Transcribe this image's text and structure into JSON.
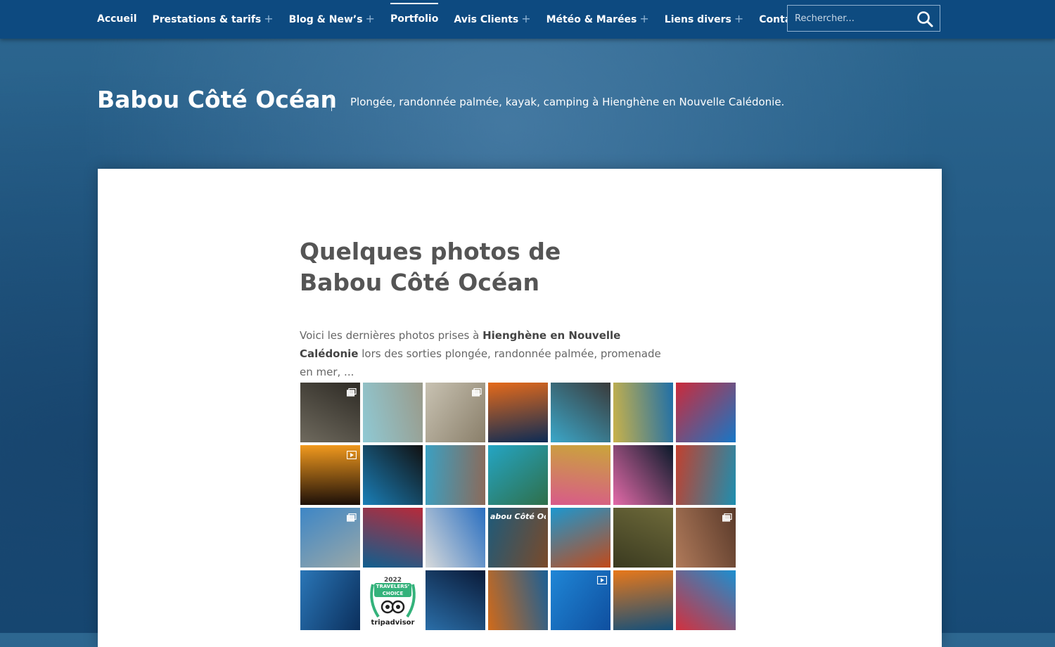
{
  "nav": {
    "items": [
      {
        "label": "Accueil",
        "has_sub": false,
        "active": false
      },
      {
        "label": "Prestations & tarifs",
        "has_sub": true,
        "active": false
      },
      {
        "label": "Blog & New’s",
        "has_sub": true,
        "active": false
      },
      {
        "label": "Portfolio",
        "has_sub": false,
        "active": true
      },
      {
        "label": "Avis Clients",
        "has_sub": true,
        "active": false
      },
      {
        "label": "Météo & Marées",
        "has_sub": true,
        "active": false
      },
      {
        "label": "Liens divers",
        "has_sub": true,
        "active": false
      },
      {
        "label": "Contact",
        "has_sub": true,
        "active": false
      }
    ],
    "sub_indicator": "+"
  },
  "search": {
    "placeholder": "Rechercher...",
    "icon": "search-icon"
  },
  "site": {
    "title": "Babou Côté Océan",
    "tagline": "Plongée, randonnée palmée, kayak, camping à Hienghène en Nouvelle Calédonie."
  },
  "page": {
    "title": "Quelques photos de Babou Côté Océan",
    "intro_before": "Voici les dernières photos prises à ",
    "intro_strong": "Hienghène en Nouvelle Calédonie",
    "intro_after": " lors des sorties plongée, randonnée palmée, promenade en mer, ..."
  },
  "colors": {
    "topbar": "#0d4a80",
    "accent": "#ffffff",
    "tripadvisor": "#34b27b"
  },
  "gallery": [
    {
      "c1": "#6f6a5e",
      "c2": "#2d2a24",
      "badge": "multi"
    },
    {
      "c1": "#8fc9d4",
      "c2": "#9a9a8a",
      "badge": ""
    },
    {
      "c1": "#c8c2b2",
      "c2": "#8a7f6a",
      "badge": "multi"
    },
    {
      "c1": "#e56a1a",
      "c2": "#0c2b55",
      "badge": ""
    },
    {
      "c1": "#3ba7c9",
      "c2": "#3a3a3a",
      "badge": ""
    },
    {
      "c1": "#c9b24a",
      "c2": "#1f6fa8",
      "badge": ""
    },
    {
      "c1": "#cc2a3a",
      "c2": "#1677c7",
      "badge": ""
    },
    {
      "c1": "#f29a1e",
      "c2": "#1a0e08",
      "badge": "video"
    },
    {
      "c1": "#1a7fb8",
      "c2": "#111111",
      "badge": ""
    },
    {
      "c1": "#3ba0c2",
      "c2": "#8b6a5a",
      "badge": ""
    },
    {
      "c1": "#24a5c4",
      "c2": "#2f6f4a",
      "badge": ""
    },
    {
      "c1": "#caa53a",
      "c2": "#d85a8a",
      "badge": ""
    },
    {
      "c1": "#e36aa8",
      "c2": "#0a1a2a",
      "badge": ""
    },
    {
      "c1": "#c2402e",
      "c2": "#1d8fb0",
      "badge": ""
    },
    {
      "c1": "#3d86c6",
      "c2": "#9aa8a8",
      "badge": "multi"
    },
    {
      "c1": "#b72a3a",
      "c2": "#0f5f8f",
      "badge": ""
    },
    {
      "c1": "#d8dadb",
      "c2": "#2a6fc0",
      "badge": ""
    },
    {
      "c1": "#1d5a7a",
      "c2": "#7a4a2a",
      "badge": "",
      "caption": "abou Côté Oce"
    },
    {
      "c1": "#1c97cf",
      "c2": "#c24a1a",
      "badge": ""
    },
    {
      "c1": "#6e6a3a",
      "c2": "#3a3a20",
      "badge": ""
    },
    {
      "c1": "#b07a5a",
      "c2": "#5a3a2a",
      "badge": "multi"
    },
    {
      "c1": "#2a76b7",
      "c2": "#0b2f5c",
      "badge": ""
    },
    {
      "tripadvisor": true,
      "year": "2022",
      "choice_top": "TRAVELERS’",
      "choice_bottom": "CHOICE",
      "brand": "tripadvisor"
    },
    {
      "c1": "#2a6ea8",
      "c2": "#0a1a38",
      "badge": ""
    },
    {
      "c1": "#d06a1a",
      "c2": "#1a5f96",
      "badge": ""
    },
    {
      "c1": "#1f86d6",
      "c2": "#0f4f9f",
      "badge": "video"
    },
    {
      "c1": "#e8781a",
      "c2": "#134f7a",
      "badge": ""
    },
    {
      "c1": "#d3303e",
      "c2": "#1c8fd0",
      "badge": ""
    }
  ]
}
